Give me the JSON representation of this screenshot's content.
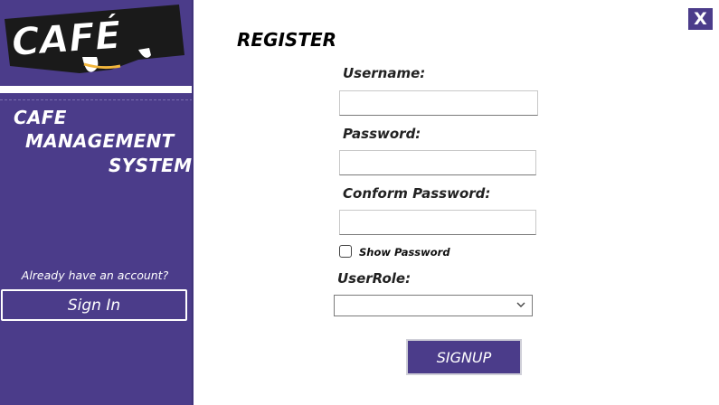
{
  "colors": {
    "accent": "#4b3c8a",
    "text_on_accent": "#ffffff",
    "logo_accent": "#f2b63c"
  },
  "sidebar": {
    "logo_text": "CAFÉ",
    "title_lines": [
      "CAFE",
      "MANAGEMENT",
      "SYSTEM"
    ],
    "already_text": "Already have an account?",
    "signin_label": "Sign In"
  },
  "window": {
    "close_label": "X"
  },
  "form": {
    "heading": "REGISTER",
    "username_label": "Username:",
    "username_value": "",
    "password_label": "Password:",
    "password_value": "",
    "confirm_label": "Conform Password:",
    "confirm_value": "",
    "show_password_label": "Show Password",
    "show_password_checked": false,
    "userrole_label": "UserRole:",
    "userrole_selected": "",
    "signup_label": "SIGNUP"
  }
}
